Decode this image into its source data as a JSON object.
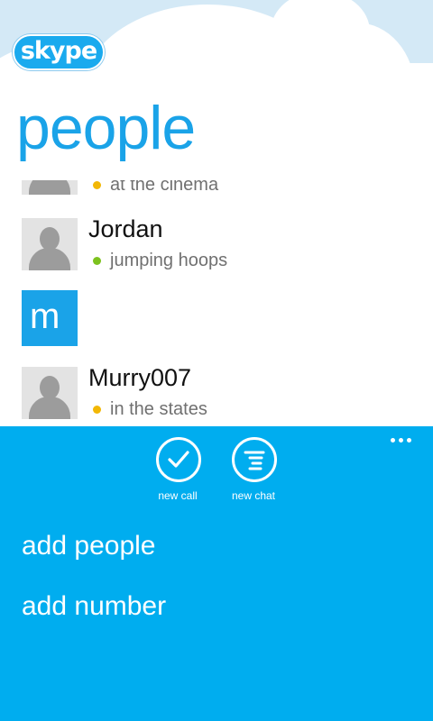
{
  "app": {
    "logo_text": "skype"
  },
  "header": {
    "title": "people"
  },
  "contacts": [
    {
      "name": "",
      "status": "at the cinema",
      "status_color": "#f2b705"
    },
    {
      "name": "Jordan",
      "status": "jumping hoops",
      "status_color": "#7dc21e"
    },
    {
      "name": "Murry007",
      "status": "in the states",
      "status_color": "#f2b705"
    }
  ],
  "group_letter": "m",
  "appbar": {
    "background": "#00adef",
    "actions": [
      {
        "label": "new call",
        "icon": "check-circle-icon"
      },
      {
        "label": "new chat",
        "icon": "chat-lines-icon"
      }
    ],
    "menu": [
      {
        "label": "add people"
      },
      {
        "label": "add number"
      }
    ],
    "more_icon": "ellipsis-icon"
  },
  "colors": {
    "accent": "#1aa3e8",
    "sky": "#d4e9f6"
  }
}
